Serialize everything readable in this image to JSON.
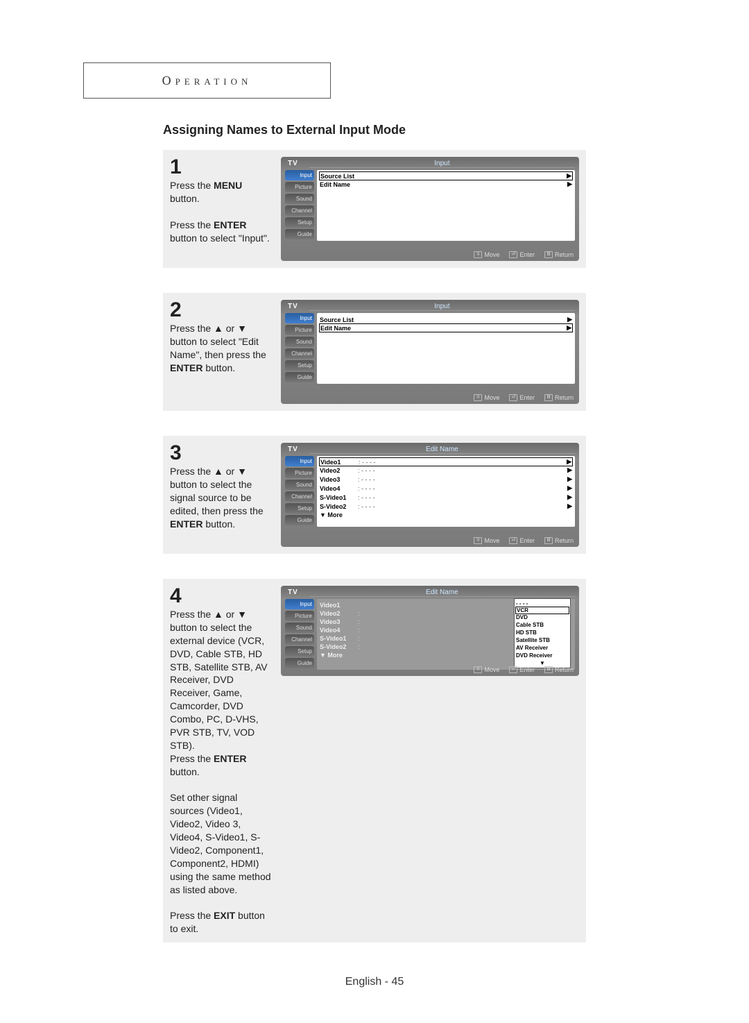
{
  "header": "Operation",
  "section_title": "Assigning Names to External Input Mode",
  "footer": "English - 45",
  "side_menu": [
    "Input",
    "Picture",
    "Sound",
    "Channel",
    "Setup",
    "Guide"
  ],
  "tv_footer": {
    "move": "Move",
    "enter": "Enter",
    "return": "Return"
  },
  "steps": {
    "s1": {
      "num": "1",
      "lines": [
        "Press the ",
        "MENU",
        " button."
      ],
      "lines2": [
        "Press the ",
        "ENTER",
        " button to select \"Input\"."
      ],
      "tv_left": "TV",
      "tv_banner": "Input",
      "menu": [
        {
          "label": "Source List",
          "sel": true,
          "arrow": "▶"
        },
        {
          "label": "Edit Name",
          "sel": false,
          "arrow": "▶"
        }
      ]
    },
    "s2": {
      "num": "2",
      "text": "Press the ▲ or ▼ button to select \"Edit Name\", then press the ",
      "text_bold": "ENTER",
      "text_after": " button.",
      "tv_left": "TV",
      "tv_banner": "Input",
      "menu": [
        {
          "label": "Source List",
          "sel": false,
          "arrow": "▶"
        },
        {
          "label": "Edit Name",
          "sel": true,
          "arrow": "▶"
        }
      ]
    },
    "s3": {
      "num": "3",
      "text": "Press the ▲ or ▼ button to select the signal source to be edited, then press the ",
      "text_bold": "ENTER",
      "text_after": " button.",
      "tv_left": "TV",
      "tv_banner": "Edit Name",
      "menu": [
        {
          "label": "Video1",
          "mid": ": - - - -",
          "sel": true,
          "arrow": "▶"
        },
        {
          "label": "Video2",
          "mid": ": - - - -",
          "arrow": "▶"
        },
        {
          "label": "Video3",
          "mid": ": - - - -",
          "arrow": "▶"
        },
        {
          "label": "Video4",
          "mid": ": - - - -",
          "arrow": "▶"
        },
        {
          "label": "S-Video1",
          "mid": ": - - - -",
          "arrow": "▶"
        },
        {
          "label": "S-Video2",
          "mid": ": - - - -",
          "arrow": "▶"
        },
        {
          "label": "▼ More",
          "mid": "",
          "arrow": ""
        }
      ]
    },
    "s4": {
      "num": "4",
      "para1": "Press the ▲ or ▼ button to select the external device (VCR, DVD, Cable STB, HD STB, Satellite STB, AV Receiver, DVD Receiver, Game, Camcorder, DVD Combo, PC, D-VHS, PVR STB, TV, VOD STB).",
      "para1b_pre": "Press the ",
      "para1b_bold": "ENTER",
      "para1b_post": " button.",
      "para2": "Set other signal sources (Video1,  Video2,  Video 3, Video4, S-Video1,  S-Video2, Component1, Component2, HDMI) using the same method as listed above.",
      "para3_pre": "Press the ",
      "para3_bold": "EXIT",
      "para3_post": " button to exit.",
      "tv_left": "TV",
      "tv_banner": "Edit Name",
      "menu": [
        {
          "label": "Video1",
          "mid": ""
        },
        {
          "label": "Video2",
          "mid": ":"
        },
        {
          "label": "Video3",
          "mid": ":"
        },
        {
          "label": "Video4",
          "mid": ":"
        },
        {
          "label": "S-Video1",
          "mid": ":"
        },
        {
          "label": "S-Video2",
          "mid": ":"
        },
        {
          "label": "▼ More",
          "mid": ""
        }
      ],
      "dropdown": [
        "- - - -",
        "VCR",
        "DVD",
        "Cable STB",
        "HD STB",
        "Satellite STB",
        "AV Receiver",
        "DVD Receiver",
        "▼"
      ]
    }
  }
}
